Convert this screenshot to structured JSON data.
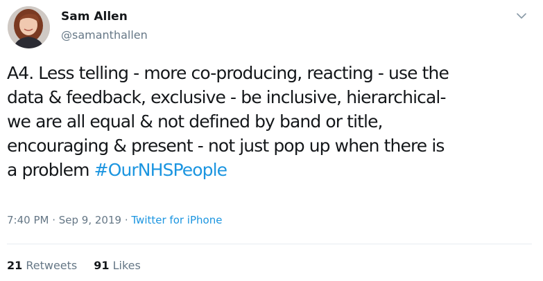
{
  "user": {
    "name": "Sam Allen",
    "handle": "@samanthallen"
  },
  "tweet": {
    "lines": [
      "A4. Less telling - more co-producing, reacting - use the",
      "data & feedback, exclusive - be inclusive, hierarchical-",
      "we are all equal & not defined by band or title,",
      "encouraging & present - not just pop up when there is",
      "a problem "
    ],
    "hashtag": "#OurNHSPeople"
  },
  "meta": {
    "time": "7:40 PM",
    "separator": " · ",
    "date": "Sep 9, 2019",
    "separator2": " · ",
    "source": "Twitter for iPhone"
  },
  "stats": {
    "retweets_count": "21",
    "retweets_label": "Retweets",
    "likes_count": "91",
    "likes_label": "Likes"
  },
  "icons": {
    "caret": "chevron-down-icon",
    "avatar": "avatar"
  },
  "colors": {
    "link": "#1b95e0",
    "secondary": "#657786",
    "primary": "#14171a"
  }
}
